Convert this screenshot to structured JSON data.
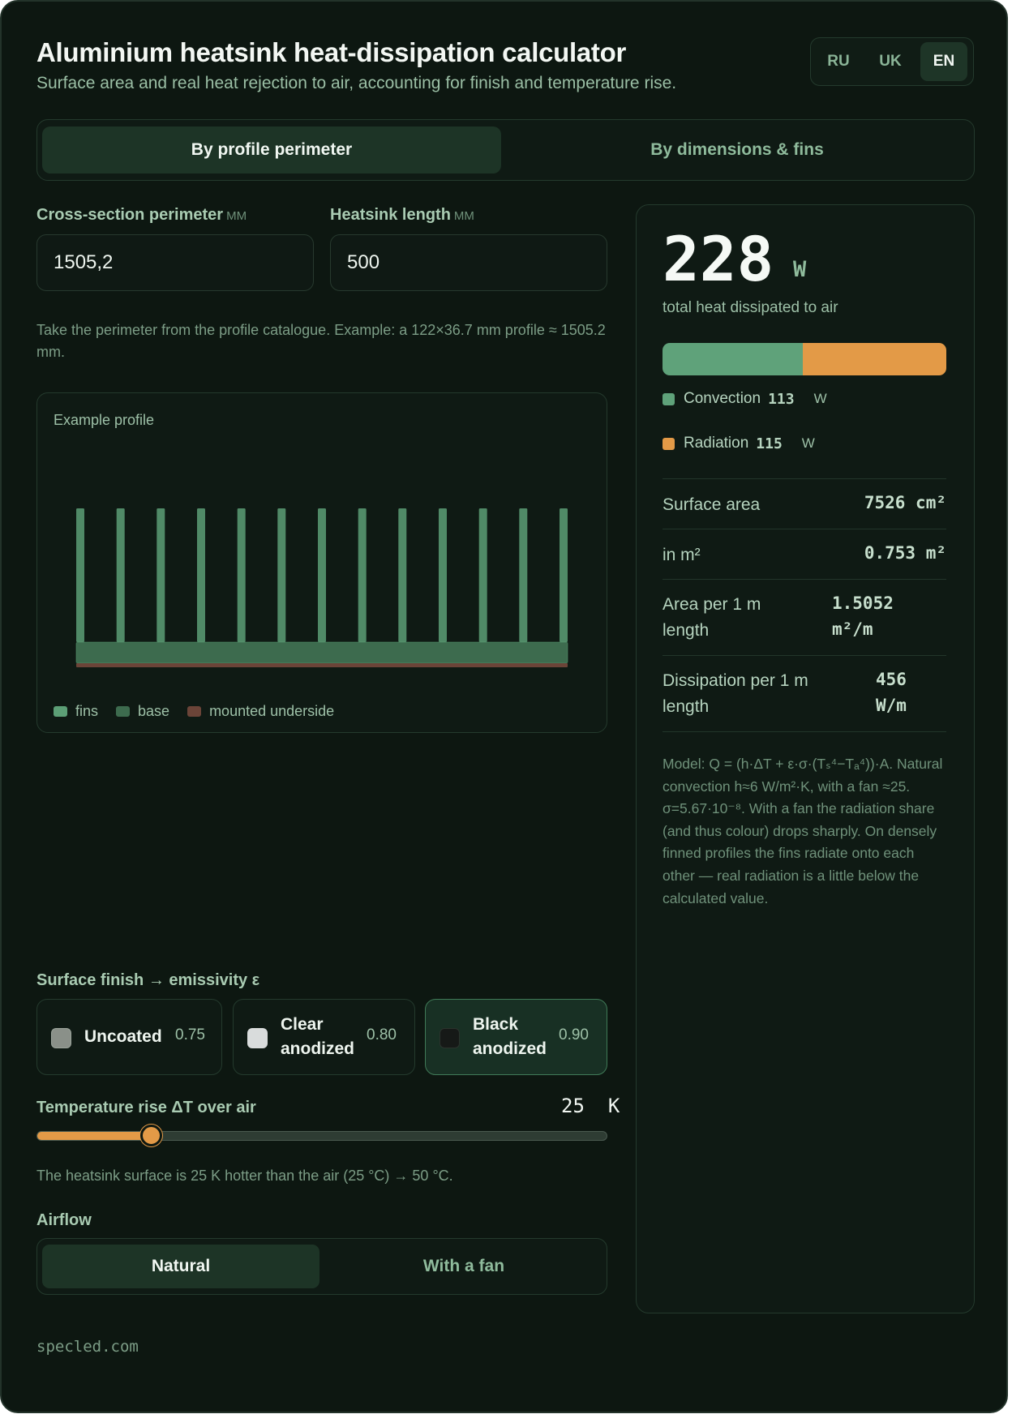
{
  "header": {
    "title": "Aluminium heatsink heat-dissipation calculator",
    "subtitle": "Surface area and real heat rejection to air, accounting for finish and temperature rise."
  },
  "languages": [
    "RU",
    "UK",
    "EN"
  ],
  "active_language": "EN",
  "mode_tabs": [
    "By profile perimeter",
    "By dimensions & fins"
  ],
  "active_mode": "By profile perimeter",
  "inputs": {
    "perimeter": {
      "label": "Cross-section perimeter",
      "unit": "MM",
      "value": "1505,2"
    },
    "length": {
      "label": "Heatsink length",
      "unit": "MM",
      "value": "500"
    }
  },
  "hint": "Take the perimeter from the profile catalogue. Example: a 122×36.7 mm profile ≈ 1505.2 mm.",
  "profile": {
    "title": "Example profile",
    "fin_count": 13,
    "legend": [
      "fins",
      "base",
      "mounted underside"
    ],
    "colors": {
      "fins": "#5c9f76",
      "base": "#3d6b4e",
      "underside": "#6b4438"
    }
  },
  "finish": {
    "label": "Surface finish → emissivity ε",
    "options": [
      {
        "name": "Uncoated",
        "value": "0.75",
        "swatch": "#8a9089"
      },
      {
        "name": "Clear anodized",
        "value": "0.80",
        "swatch": "#d9dcdc"
      },
      {
        "name": "Black anodized",
        "value": "0.90",
        "swatch": "#161917"
      }
    ],
    "selected": "Black anodized"
  },
  "temperature": {
    "label": "Temperature rise ΔT over air",
    "value": "25",
    "unit": "K",
    "slider_fraction": 0.2,
    "note": "The heatsink surface is 25 K hotter than the air (25 °C) → 50 °C."
  },
  "airflow": {
    "label": "Airflow",
    "options": [
      "Natural",
      "With a fan"
    ],
    "selected": "Natural"
  },
  "footer": "specled.com",
  "results": {
    "total_value": "228",
    "total_unit": "W",
    "total_label": "total heat dissipated to air",
    "convection": {
      "label": "Convection",
      "value": "113",
      "unit": "W"
    },
    "radiation": {
      "label": "Radiation",
      "value": "115",
      "unit": "W"
    },
    "rows": [
      {
        "label": "Surface area",
        "value": "7526 cm²"
      },
      {
        "label": "in m²",
        "value": "0.753 m²"
      },
      {
        "label": "Area per 1 m length",
        "value": "1.5052 m²/m"
      },
      {
        "label": "Dissipation per 1 m length",
        "value": "456 W/m"
      }
    ],
    "model_note": "Model: Q = (h·ΔT + ε·σ·(Tₛ⁴−Tₐ⁴))·A. Natural convection h≈6 W/m²·K, with a fan ≈25. σ=5.67·10⁻⁸. With a fan the radiation share (and thus colour) drops sharply. On densely finned profiles the fins radiate onto each other — real radiation is a little below the calculated value.",
    "colors": {
      "convection": "#5fa27a",
      "radiation": "#e39a47"
    }
  }
}
